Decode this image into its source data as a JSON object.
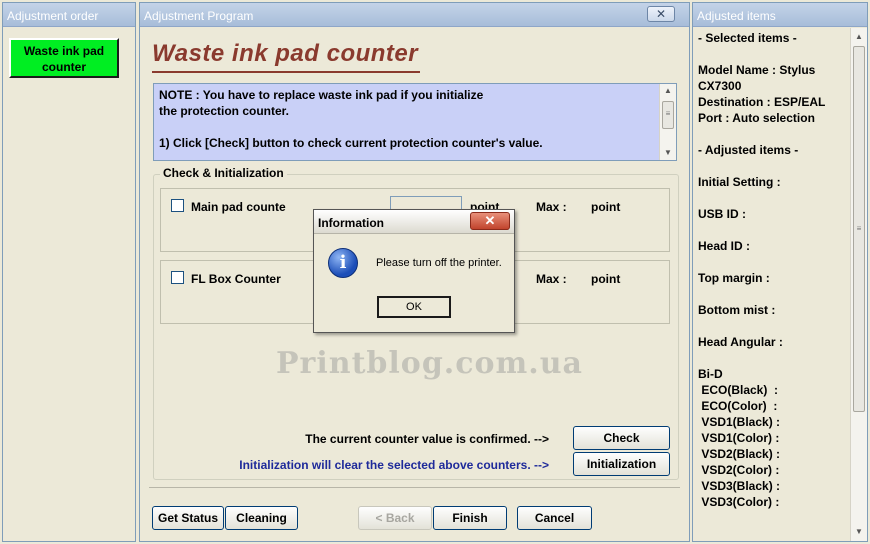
{
  "left_panel": {
    "title": "Adjustment order",
    "items": [
      {
        "label": "Waste ink pad\ncounter"
      }
    ]
  },
  "center_panel": {
    "title": "Adjustment Program",
    "close_icon": "close-x-icon",
    "heading": "Waste ink pad counter",
    "note": {
      "line1": "NOTE : You have to replace waste ink pad if you initialize",
      "line2": "the protection counter.",
      "line3": "1) Click [Check] button to check current protection counter's value."
    },
    "group": {
      "label": "Check & Initialization",
      "main_pad": {
        "label": "Main pad counte",
        "unit": "point",
        "max_label": "Max :",
        "max_unit": "point"
      },
      "fl_box": {
        "label": "FL Box Counter",
        "max_label": "Max :",
        "max_unit": "point"
      },
      "confirm_text": "The current counter value is confirmed. -->",
      "check_button": "Check",
      "init_text": "Initialization will clear the selected above counters. -->",
      "init_button": "Initialization"
    },
    "buttons": {
      "get_status": "Get Status",
      "cleaning": "Cleaning",
      "back": "< Back",
      "finish": "Finish",
      "cancel": "Cancel"
    },
    "watermark": "Printblog.com.ua"
  },
  "right_panel": {
    "title": "Adjusted items",
    "selected_header": "- Selected items -",
    "model_line1": "Model Name : Stylus",
    "model_line2": "CX7300",
    "destination": "Destination : ESP/EAL",
    "port": "Port : Auto selection",
    "adjusted_header": "- Adjusted items -",
    "initial_setting": "Initial Setting :",
    "usb_id": "USB ID :",
    "head_id": "Head ID :",
    "top_margin": "Top margin :",
    "bottom_mist": "Bottom mist :",
    "head_angular": "Head Angular :",
    "bid": "Bi-D",
    "bid_items": [
      " ECO(Black)  :",
      " ECO(Color)  :",
      " VSD1(Black) :",
      " VSD1(Color) :",
      " VSD2(Black) :",
      " VSD2(Color) :",
      " VSD3(Black) :",
      " VSD3(Color) :"
    ]
  },
  "dialog": {
    "title": "Information",
    "icon": "info-icon",
    "message": "Please turn off the printer.",
    "ok": "OK"
  },
  "colors": {
    "accent_green": "#00ee22",
    "heading_brown": "#8a3a2e",
    "note_bg": "#c9d0f7",
    "init_text_blue": "#1e2a9a",
    "panel_title_bg": "#b4c7e2"
  }
}
